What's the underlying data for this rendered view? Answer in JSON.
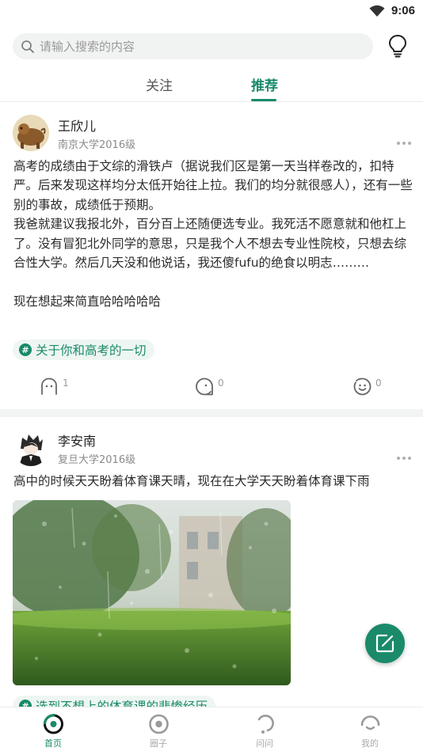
{
  "status_bar": {
    "time": "9:06"
  },
  "search": {
    "placeholder": "请输入搜索的内容"
  },
  "tabs": [
    {
      "label": "关注",
      "active": false
    },
    {
      "label": "推荐",
      "active": true
    }
  ],
  "colors": {
    "accent": "#1a8a6a",
    "tag_bg": "#eef6f2",
    "separator": "#f2f3f3"
  },
  "posts": [
    {
      "author": "王欣儿",
      "school": "南京大学2016级",
      "text": "高考的成绩由于文综的滑铁卢（据说我们区是第一天当样卷改的，扣特严。后来发现这样均分太低开始往上拉。我们的均分就很感人），还有一些别的事故，成绩低于预期。\n我爸就建议我报北外，百分百上还随便选专业。我死活不愿意就和他杠上了。没有冒犯北外同学的意思，只是我个人不想去专业性院校，只想去综合性大学。然后几天没和他说话，我还傻fufu的绝食以明志………\n\n现在想起来简直哈哈哈哈哈",
      "topic": "关于你和高考的一切",
      "actions": {
        "comment_count": "1",
        "dislike_count": "0",
        "like_count": "0"
      }
    },
    {
      "author": "李安南",
      "school": "复旦大学2016级",
      "text": "高中的时候天天盼着体育课天晴，现在在大学天天盼着体育课下雨",
      "topic": "选到不想上的体育课的悲惨经历"
    }
  ],
  "bottom_nav": [
    {
      "label": "首页",
      "icon": "home-icon",
      "active": true
    },
    {
      "label": "圈子",
      "icon": "circle-icon",
      "active": false
    },
    {
      "label": "问问",
      "icon": "question-icon",
      "active": false
    },
    {
      "label": "我的",
      "icon": "profile-icon",
      "active": false
    }
  ]
}
